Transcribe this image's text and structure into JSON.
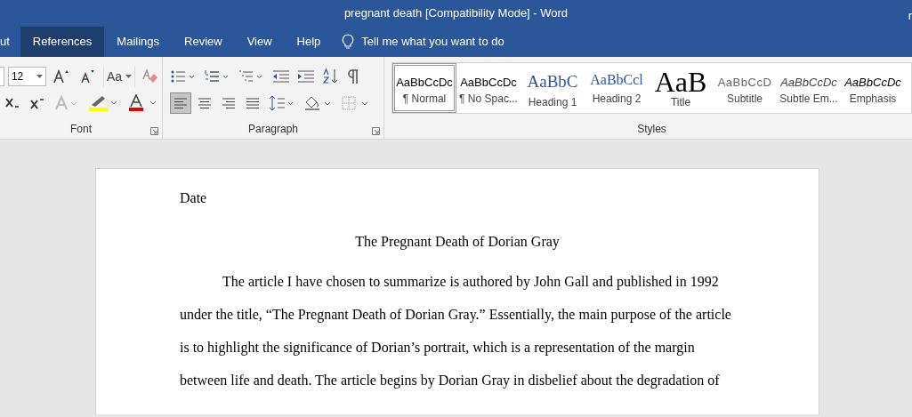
{
  "window": {
    "title": "pregnant death [Compatibility Mode]  -  Word",
    "user_name": "r"
  },
  "tabs": [
    {
      "label": "ut",
      "selected": false
    },
    {
      "label": "References",
      "selected": true
    },
    {
      "label": "Mailings",
      "selected": false
    },
    {
      "label": "Review",
      "selected": false
    },
    {
      "label": "View",
      "selected": false
    },
    {
      "label": "Help",
      "selected": false
    }
  ],
  "tell_me": {
    "placeholder": "Tell me what you want to do"
  },
  "font_group": {
    "label": "Font",
    "font_size": "12",
    "case_button": "Aa",
    "row1": [
      {
        "kind": "grow"
      },
      {
        "kind": "shrink"
      },
      {
        "kind": "case"
      },
      {
        "kind": "clear"
      }
    ],
    "row2": [
      {
        "kind": "subscript"
      },
      {
        "kind": "superscript"
      },
      {
        "kind": "effects"
      },
      {
        "kind": "highlight"
      },
      {
        "kind": "fontcolor"
      }
    ]
  },
  "paragraph_group": {
    "label": "Paragraph",
    "row1": [
      {
        "kind": "bullets"
      },
      {
        "kind": "numbering"
      },
      {
        "kind": "multilevel"
      },
      {
        "kind": "outdent"
      },
      {
        "kind": "indent"
      },
      {
        "kind": "sort"
      },
      {
        "kind": "marks"
      }
    ],
    "row2": [
      {
        "kind": "align-left",
        "selected": true
      },
      {
        "kind": "align-center",
        "selected": false
      },
      {
        "kind": "align-right",
        "selected": false
      },
      {
        "kind": "justify",
        "selected": false
      },
      {
        "kind": "spacing"
      },
      {
        "kind": "shading"
      },
      {
        "kind": "borders"
      }
    ]
  },
  "styles_group": {
    "label": "Styles",
    "styles": [
      {
        "preview": "AaBbCcDc",
        "name": "¶ Normal",
        "kind": "normal",
        "selected": true
      },
      {
        "preview": "AaBbCcDc",
        "name": "¶ No Spac...",
        "kind": "normal",
        "selected": false
      },
      {
        "preview": "AaBbC",
        "name": "Heading 1",
        "kind": "heading1",
        "selected": false
      },
      {
        "preview": "AaBbCcl",
        "name": "Heading 2",
        "kind": "heading2",
        "selected": false
      },
      {
        "preview": "AaB",
        "name": "Title",
        "kind": "title",
        "selected": false
      },
      {
        "preview": "AaBbCcD",
        "name": "Subtitle",
        "kind": "subtitle",
        "selected": false
      },
      {
        "preview": "AaBbCcDc",
        "name": "Subtle Em...",
        "kind": "subtle",
        "selected": false
      },
      {
        "preview": "AaBbCcDc",
        "name": "Emphasis",
        "kind": "emphasis",
        "selected": false
      }
    ]
  },
  "document": {
    "date": "Date",
    "title": "The Pregnant Death of Dorian Gray",
    "paragraph": "The article I have chosen to summarize is authored by John Gall and published in 1992 under the title, “The Pregnant Death of Dorian Gray.” Essentially, the main purpose of the article is to highlight the significance of Dorian’s portrait, which is a representation of the margin between life and death. The article begins by Dorian Gray in disbelief about the degradation of"
  }
}
